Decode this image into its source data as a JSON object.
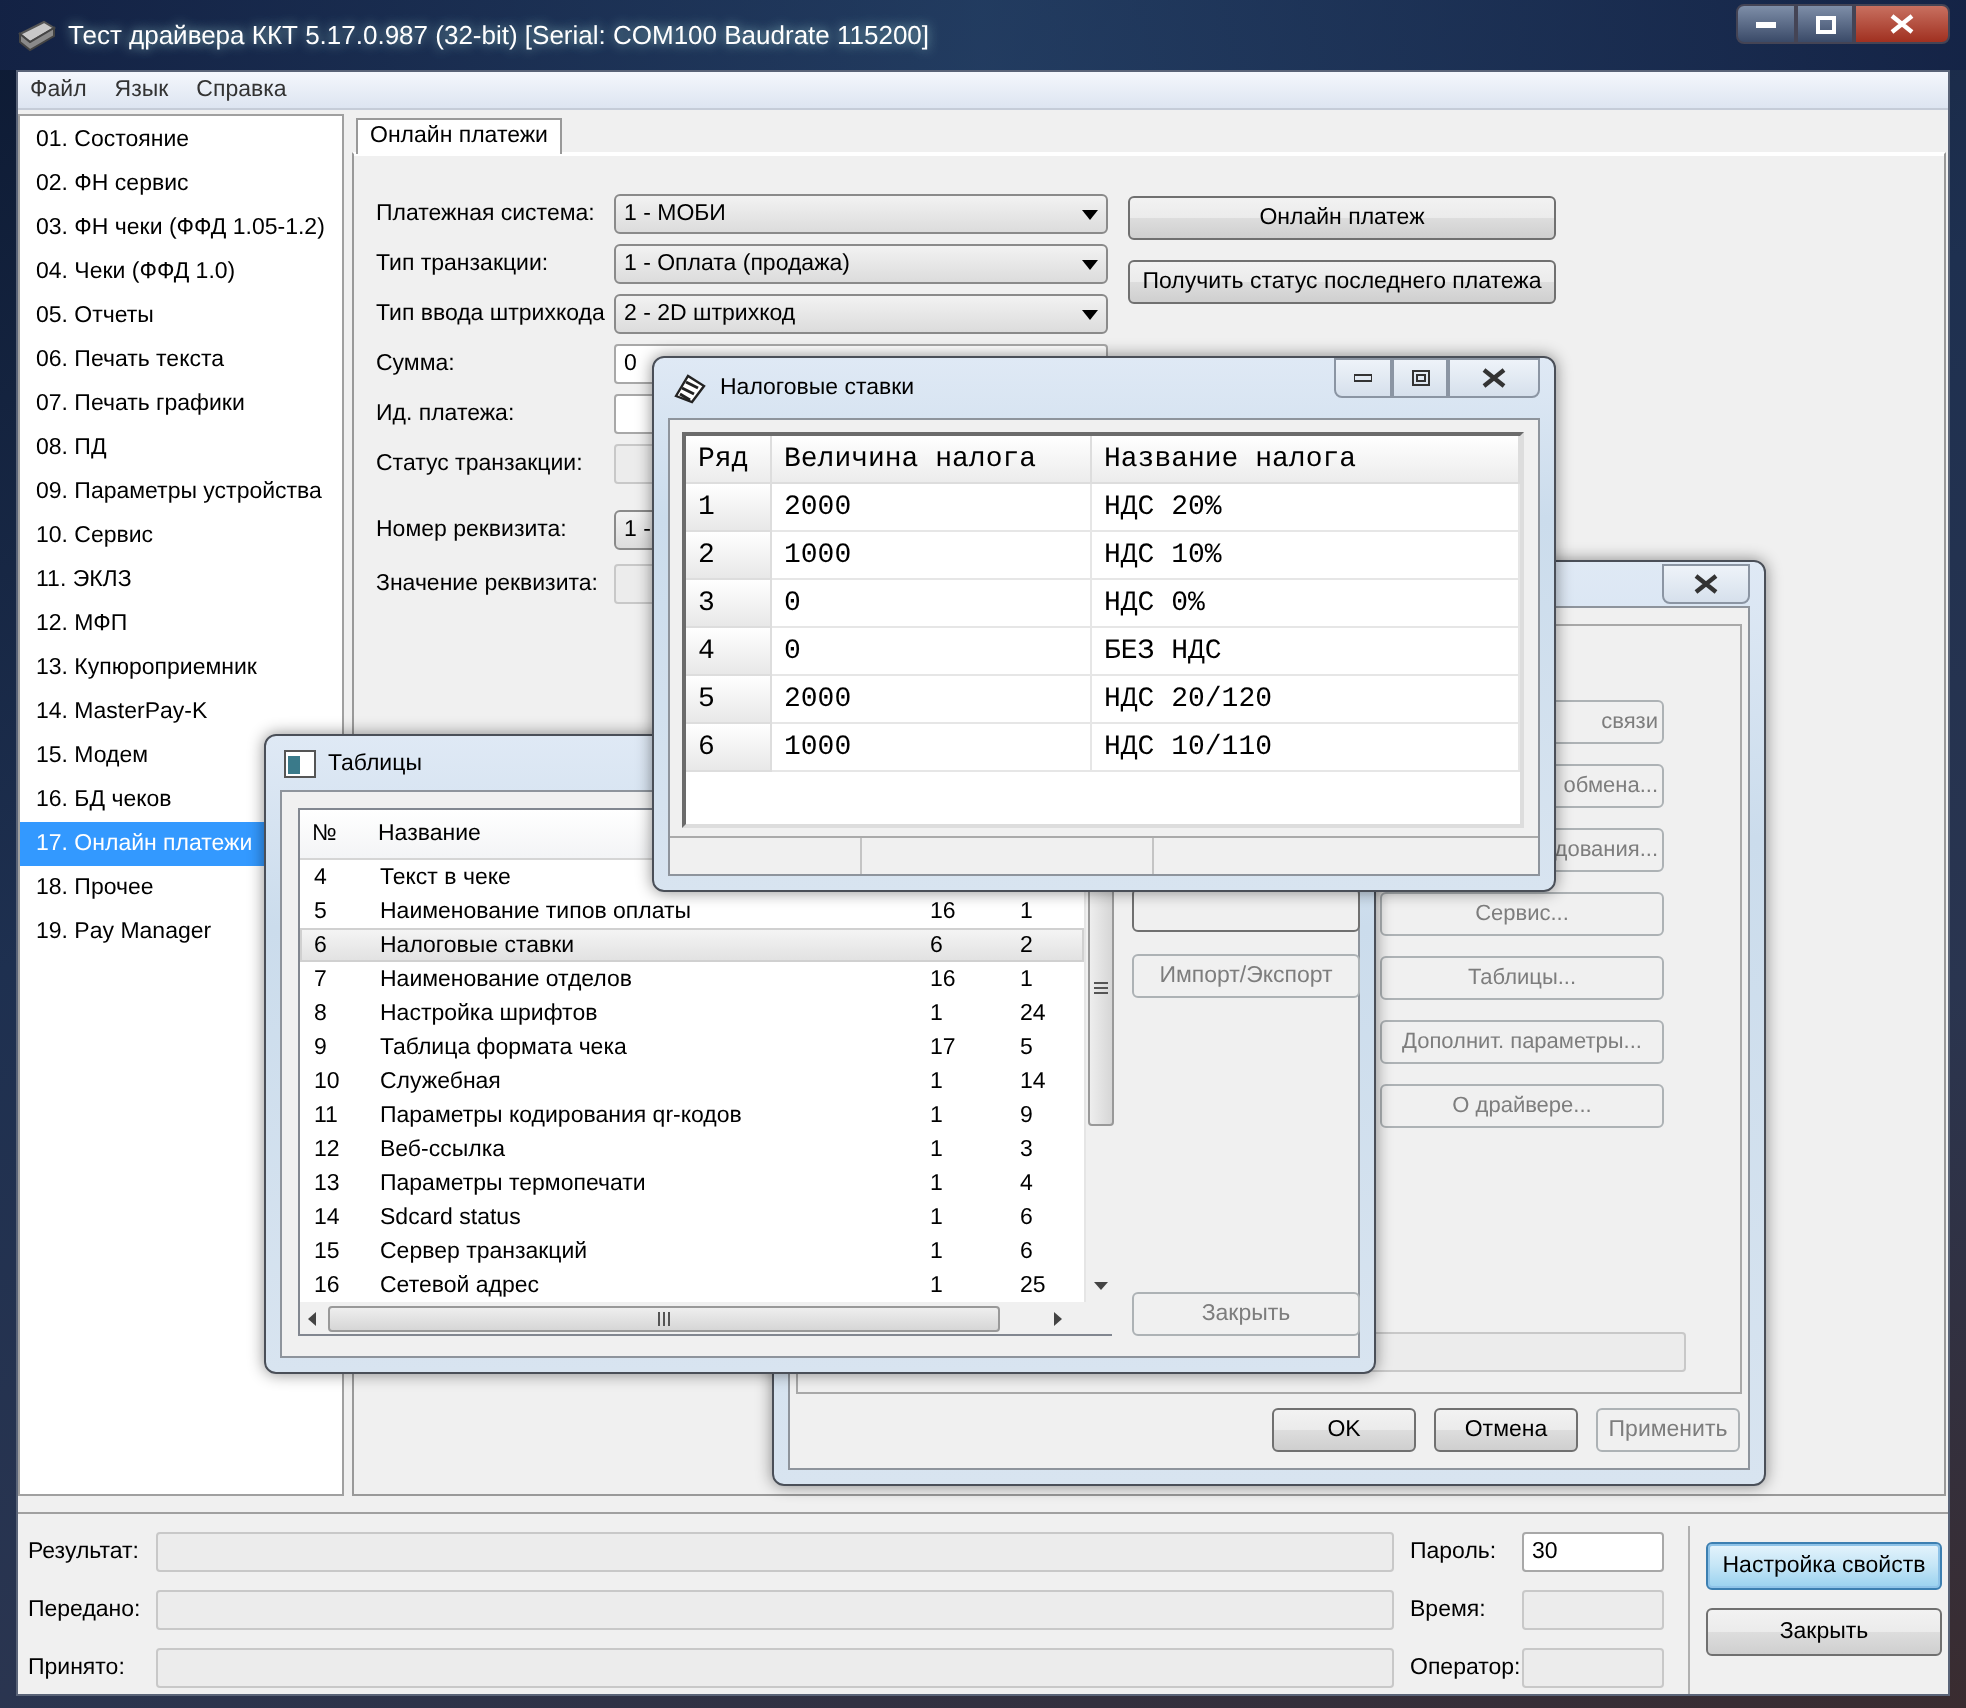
{
  "window": {
    "title": "Тест драйвера ККТ 5.17.0.987 (32-bit) [Serial: COM100 Baudrate 115200]"
  },
  "menu": [
    {
      "label": "Файл"
    },
    {
      "label": "Язык"
    },
    {
      "label": "Справка"
    }
  ],
  "sidebar": {
    "items": [
      {
        "label": "01. Состояние",
        "selected": false
      },
      {
        "label": "02. ФН сервис",
        "selected": false
      },
      {
        "label": "03. ФН чеки (ФФД 1.05-1.2)",
        "selected": false
      },
      {
        "label": "04. Чеки (ФФД 1.0)",
        "selected": false
      },
      {
        "label": "05. Отчеты",
        "selected": false
      },
      {
        "label": "06. Печать текста",
        "selected": false
      },
      {
        "label": "07. Печать графики",
        "selected": false
      },
      {
        "label": "08. ПД",
        "selected": false
      },
      {
        "label": "09. Параметры устройства",
        "selected": false
      },
      {
        "label": "10. Сервис",
        "selected": false
      },
      {
        "label": "11. ЭКЛЗ",
        "selected": false
      },
      {
        "label": "12. МФП",
        "selected": false
      },
      {
        "label": "13. Купюроприемник",
        "selected": false
      },
      {
        "label": "14. MasterPay-K",
        "selected": false
      },
      {
        "label": "15. Модем",
        "selected": false
      },
      {
        "label": "16. БД чеков",
        "selected": false
      },
      {
        "label": "17. Онлайн платежи",
        "selected": true
      },
      {
        "label": "18. Прочее",
        "selected": false
      },
      {
        "label": "19. Pay Manager",
        "selected": false
      }
    ]
  },
  "tabs": [
    {
      "label": "Онлайн платежи",
      "selected": true
    }
  ],
  "form": {
    "fields": [
      {
        "label": "Платежная система:",
        "kind": "select",
        "value": "1 - МОБИ"
      },
      {
        "label": "Тип транзакции:",
        "kind": "select",
        "value": "1 - Оплата (продажа)"
      },
      {
        "label": "Тип ввода штрихкода",
        "kind": "select",
        "value": "2 - 2D штрихкод"
      },
      {
        "label": "Сумма:",
        "kind": "input",
        "value": "0"
      },
      {
        "label": "Ид. платежа:",
        "kind": "input"
      },
      {
        "label": "Статус транзакции:",
        "kind": "readonly"
      }
    ],
    "requisite_fields": [
      {
        "label": "Номер реквизита:",
        "kind": "select",
        "value": "1 -"
      },
      {
        "label": "Значение реквизита:",
        "kind": "readonly"
      }
    ]
  },
  "actions": [
    {
      "label": "Онлайн платеж"
    },
    {
      "label": "Получить статус последнего платежа"
    }
  ],
  "status_panel": {
    "fields": [
      {
        "label": "Результат:"
      },
      {
        "label": "Передано:"
      },
      {
        "label": "Принято:"
      }
    ],
    "side_fields": [
      {
        "label": "Пароль:",
        "kind": "input",
        "value": "30"
      },
      {
        "label": "Время:",
        "kind": "readonly"
      },
      {
        "label": "Оператор:",
        "kind": "readonly"
      }
    ],
    "buttons": [
      {
        "label": "Настройка свойств",
        "focused": true
      },
      {
        "label": "Закрыть",
        "focused": false
      }
    ]
  },
  "properties_dialog": {
    "buttons": [
      {
        "label": "связи"
      },
      {
        "label": "обмена..."
      },
      {
        "label": "дования..."
      },
      {
        "label": "Сервис..."
      },
      {
        "label": "Таблицы..."
      },
      {
        "label": "Дополнит. параметры..."
      },
      {
        "label": "О драйвере..."
      }
    ],
    "footer_buttons": [
      {
        "label": "OK",
        "disabled": false
      },
      {
        "label": "Отмена",
        "disabled": false
      },
      {
        "label": "Применить",
        "disabled": true
      }
    ]
  },
  "tables_dialog": {
    "title": "Таблицы",
    "columns": [
      "№",
      "Название"
    ],
    "rows": [
      {
        "cells": [
          "4",
          "Текст в чеке"
        ],
        "selected": false
      },
      {
        "cells": [
          "5",
          "Наименование типов оплаты",
          "16",
          "1"
        ],
        "selected": false
      },
      {
        "cells": [
          "6",
          "Налоговые ставки",
          "6",
          "2"
        ],
        "selected": true
      },
      {
        "cells": [
          "7",
          "Наименование отделов",
          "16",
          "1"
        ],
        "selected": false
      },
      {
        "cells": [
          "8",
          "Настройка шрифтов",
          "1",
          "24"
        ],
        "selected": false
      },
      {
        "cells": [
          "9",
          "Таблица формата чека",
          "17",
          "5"
        ],
        "selected": false
      },
      {
        "cells": [
          "10",
          "Служебная",
          "1",
          "14"
        ],
        "selected": false
      },
      {
        "cells": [
          "11",
          "Параметры кодирования qr-кодов",
          "1",
          "9"
        ],
        "selected": false
      },
      {
        "cells": [
          "12",
          "Веб-ссылка",
          "1",
          "3"
        ],
        "selected": false
      },
      {
        "cells": [
          "13",
          "Параметры термопечати",
          "1",
          "4"
        ],
        "selected": false
      },
      {
        "cells": [
          "14",
          "Sdcard status",
          "1",
          "6"
        ],
        "selected": false
      },
      {
        "cells": [
          "15",
          "Сервер транзакций",
          "1",
          "6"
        ],
        "selected": false
      },
      {
        "cells": [
          "16",
          "Сетевой адрес",
          "1",
          "25"
        ],
        "selected": false
      }
    ],
    "buttons": [
      {
        "label": "Импорт/Экспорт"
      },
      {
        "label": "Закрыть"
      }
    ]
  },
  "tax_dialog": {
    "title": "Налоговые ставки",
    "columns": [
      "Ряд",
      "Величина налога",
      "Название налога"
    ],
    "rows": [
      {
        "cells": [
          "1",
          "2000",
          "НДС 20%"
        ]
      },
      {
        "cells": [
          "2",
          "1000",
          "НДС 10%"
        ]
      },
      {
        "cells": [
          "3",
          "0",
          "НДС 0%"
        ]
      },
      {
        "cells": [
          "4",
          "0",
          "БЕЗ НДС"
        ]
      },
      {
        "cells": [
          "5",
          "2000",
          "НДС 20/120"
        ]
      },
      {
        "cells": [
          "6",
          "1000",
          "НДС 10/110"
        ]
      }
    ]
  }
}
